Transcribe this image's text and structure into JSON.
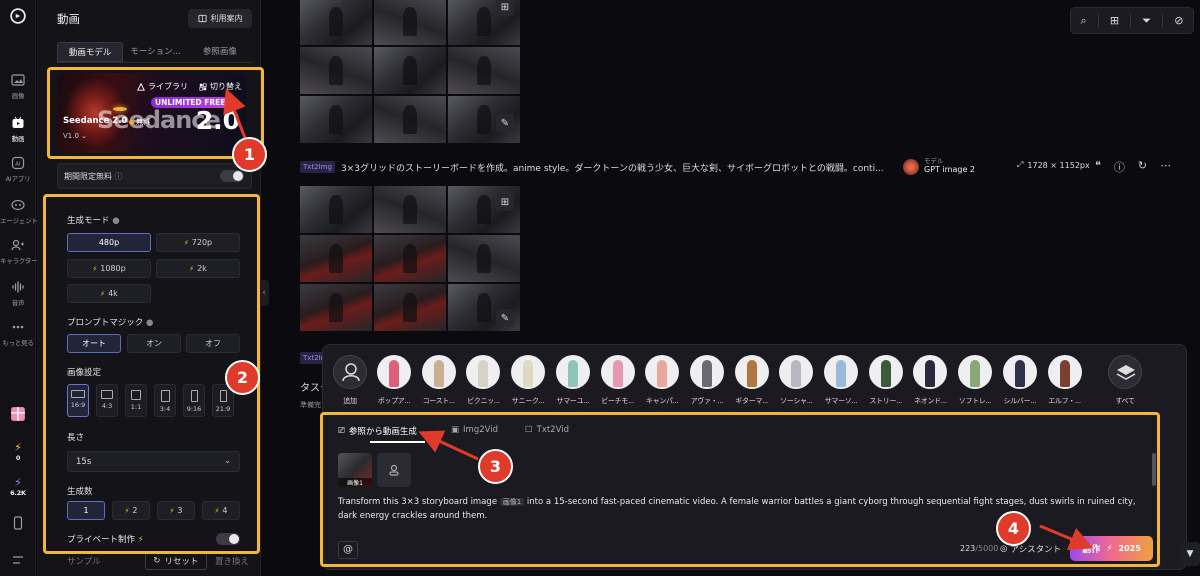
{
  "rail": {
    "items": [
      {
        "label": "画像",
        "icon": "image-icon"
      },
      {
        "label": "動画",
        "icon": "video-icon"
      },
      {
        "label": "AIアプリ",
        "icon": "ai-app-icon"
      },
      {
        "label": "エージェント",
        "icon": "agent-icon"
      },
      {
        "label": "キャラクター",
        "icon": "character-icon"
      },
      {
        "label": "音声",
        "icon": "audio-icon"
      },
      {
        "label": "もっと見る",
        "icon": "more-icon"
      }
    ],
    "credit1": "0",
    "credit2": "6.2K"
  },
  "panel": {
    "title": "動画",
    "guide_label": "利用案内",
    "tabs": [
      "動画モデル",
      "モーション...",
      "参照画像"
    ],
    "model": {
      "library_label": "ライブラリ",
      "switch_label": "切り替え",
      "free_badge": "UNLIMITED FREE",
      "name": "Seedance 2.0",
      "bg_text": "Seedance",
      "bg_version": "2.0",
      "price_label": "無料",
      "version": "V1.0"
    },
    "limited_label": "期間限定無料",
    "mode": {
      "title": "生成モード",
      "options": [
        "480p",
        "720p",
        "1080p",
        "2k",
        "4k"
      ]
    },
    "magic": {
      "title": "プロンプトマジック",
      "options": [
        "オート",
        "オン",
        "オフ"
      ]
    },
    "aspect": {
      "title": "画像設定",
      "options": [
        "16:9",
        "4:3",
        "1:1",
        "3:4",
        "9:16",
        "21:9"
      ]
    },
    "duration": {
      "title": "長さ",
      "value": "15s"
    },
    "count": {
      "title": "生成数",
      "options": [
        "1",
        "2",
        "3",
        "4"
      ]
    },
    "private_label": "プライベート制作",
    "bottom": {
      "sample": "サンプル",
      "reset": "リセット",
      "replace": "置き換え"
    }
  },
  "main": {
    "prompt": {
      "tag": "Txt2Img",
      "text": "3×3グリッドのストーリーボードを作成。anime style。ダークトーンの戦う少女、巨大な剣、サイボーグロボットとの戦闘。conti...",
      "model_label": "モデル",
      "model_value": "GPT image 2",
      "dims": "1728 × 1152px"
    },
    "tag2": "Txt2Img",
    "task_text": "タスク",
    "ready_text": "準備完"
  },
  "popup": {
    "add_label": "追加",
    "all_label": "すべて",
    "characters": [
      {
        "label": "ポップア...",
        "color": "#e0607a"
      },
      {
        "label": "コースト...",
        "color": "#c9b090"
      },
      {
        "label": "ビクニッ...",
        "color": "#d8d2c4"
      },
      {
        "label": "サニーク...",
        "color": "#e0d8c0"
      },
      {
        "label": "サマーユ...",
        "color": "#8fc4b8"
      },
      {
        "label": "ビーチモ...",
        "color": "#e598b0"
      },
      {
        "label": "キャンパ...",
        "color": "#e8a8a0"
      },
      {
        "label": "アヴァ・...",
        "color": "#6a6a72"
      },
      {
        "label": "ギターマ...",
        "color": "#b07840"
      },
      {
        "label": "ソーシャ...",
        "color": "#b8b8c0"
      },
      {
        "label": "サマーソ...",
        "color": "#9ab8d8"
      },
      {
        "label": "ストリー...",
        "color": "#3a5a38"
      },
      {
        "label": "ネオンド...",
        "color": "#2a2a3a"
      },
      {
        "label": "ソフトレ...",
        "color": "#88a878"
      },
      {
        "label": "シルバー...",
        "color": "#30304a"
      },
      {
        "label": "エルフ・...",
        "color": "#7a4030"
      }
    ],
    "tabs": [
      "参照から動画生成",
      "Img2Vid",
      "Txt2Vid"
    ],
    "thumb_caption": "画像1",
    "prompt_before": "Transform this 3×3 storyboard image",
    "prompt_tag": "画像1",
    "prompt_after": "into a 15-second fast-paced cinematic video. A female warrior battles a giant cyborg through sequential fight stages, dust swirls in ruined city, dark energy crackles around them.",
    "char_count": "223",
    "char_max": "/5000",
    "assistant_label": "アシスタント",
    "create_label": "創作",
    "create_cost": "2025"
  },
  "annotations": [
    "1",
    "2",
    "3",
    "4"
  ],
  "colors": {
    "accent_highlight": "#f2b73a",
    "badge_red": "#e03b2a",
    "primary_purple": "#9b4bf0"
  }
}
